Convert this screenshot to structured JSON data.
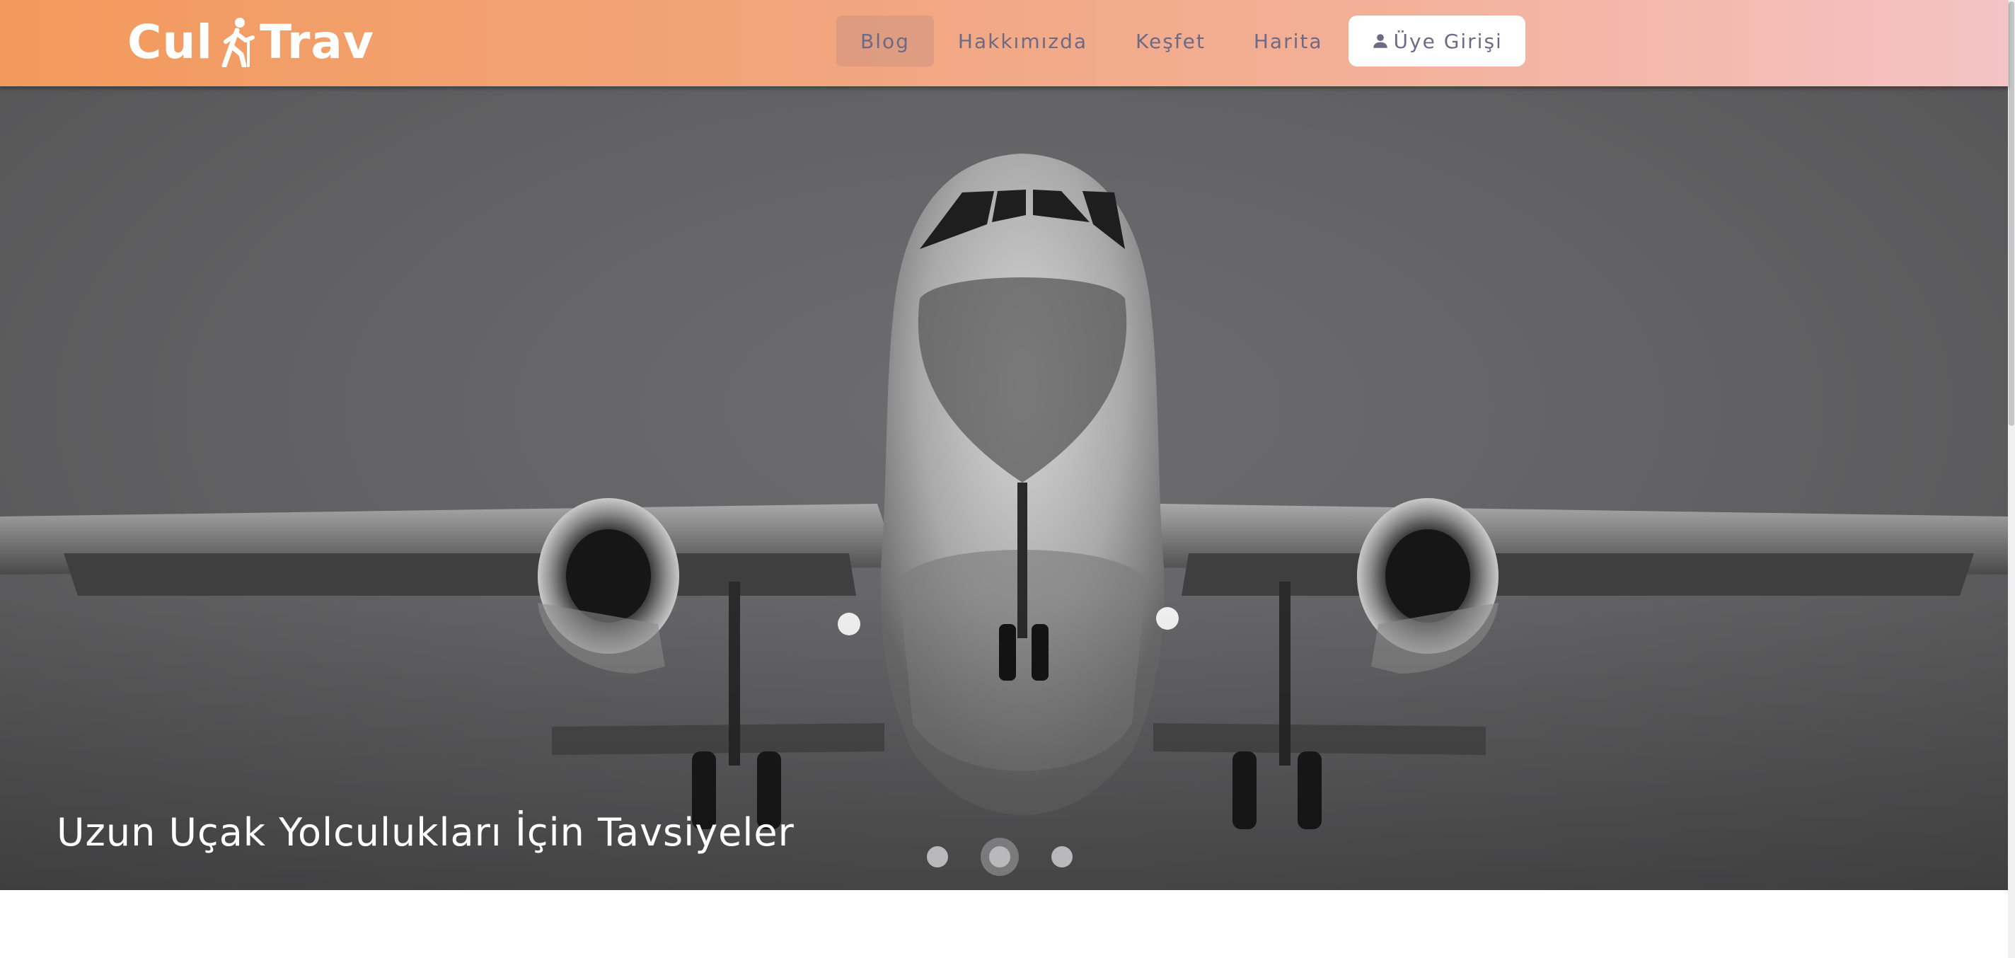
{
  "navbar": {
    "logo": {
      "text_left": "Cul",
      "text_right": "Trav",
      "icon": "walking-person-icon"
    },
    "items": [
      {
        "label": "Blog",
        "active": true
      },
      {
        "label": "Hakkımızda",
        "active": false
      },
      {
        "label": "Keşfet",
        "active": false
      },
      {
        "label": "Harita",
        "active": false
      }
    ],
    "login": {
      "label": "Üye Girişi",
      "icon": "user-icon"
    }
  },
  "carousel": {
    "slide_title": "Uzun Uçak Yolculukları İçin Tavsiyeler",
    "image": "grayscale airplane front view landing",
    "indicator_count": 3,
    "active_indicator": 2
  },
  "colors": {
    "navbar_gradient_start": "#f29a5c",
    "navbar_gradient_end": "#f4c3c5",
    "nav_text": "#6e6a86"
  }
}
